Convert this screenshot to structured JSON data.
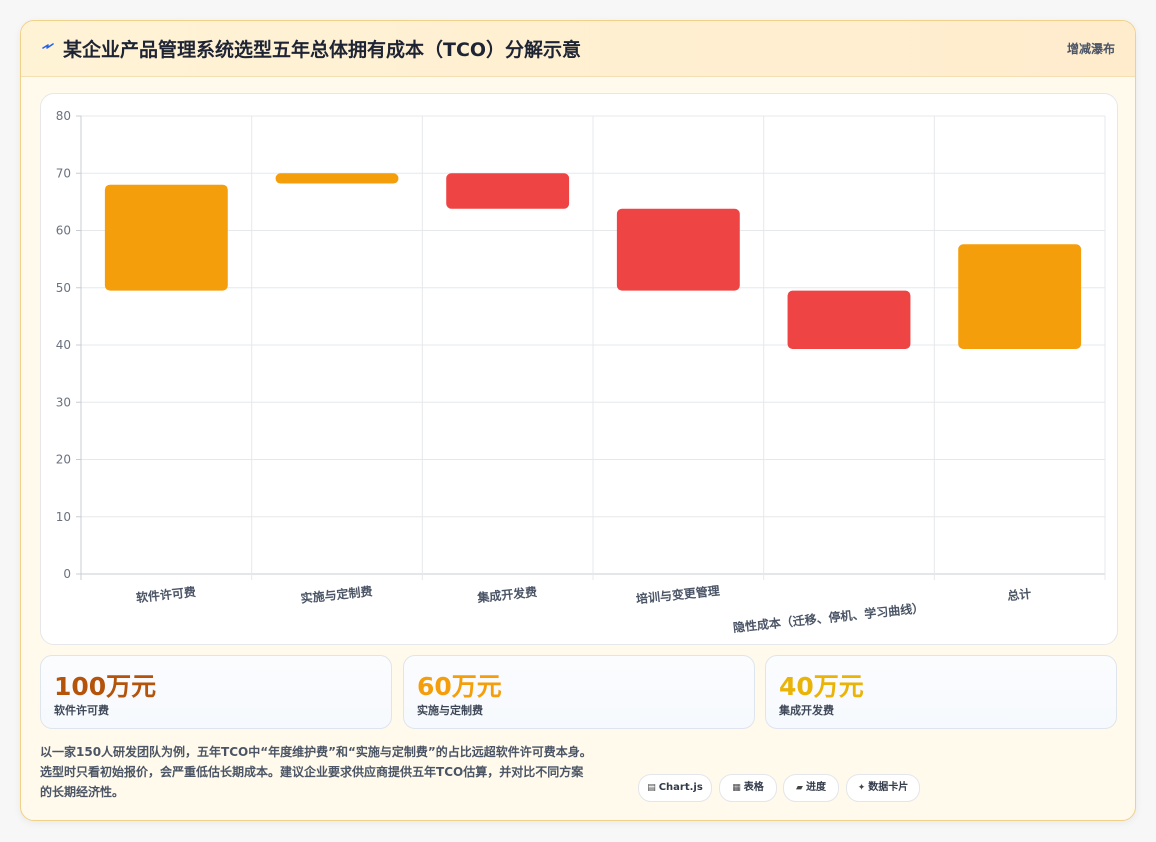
{
  "header": {
    "title": "某企业产品管理系统选型五年总体拥有成本（TCO）分解示意",
    "tag": "增减瀑布",
    "icon": "lightning-icon"
  },
  "chart_data": {
    "type": "bar",
    "subtype": "waterfall",
    "categories": [
      "软件许可费",
      "实施与定制费",
      "集成开发费",
      "培训与变更管理",
      "隐性成本（迁移、停机、学习曲线）",
      "总计"
    ],
    "bars": [
      {
        "low": 49.5,
        "high": 68,
        "color": "#f59e0b"
      },
      {
        "low": 68.2,
        "high": 70,
        "color": "#f59e0b"
      },
      {
        "low": 63.8,
        "high": 70,
        "color": "#ef4444"
      },
      {
        "low": 49.5,
        "high": 63.8,
        "color": "#ef4444"
      },
      {
        "low": 39.3,
        "high": 49.5,
        "color": "#ef4444"
      },
      {
        "low": 39.3,
        "high": 57.6,
        "color": "#f59e0b"
      }
    ],
    "ylim": [
      0,
      80
    ],
    "yticks": [
      0,
      10,
      20,
      30,
      40,
      50,
      60,
      70,
      80
    ],
    "grid": true,
    "legend": "none"
  },
  "stats": [
    {
      "value": "100万元",
      "label": "软件许可费",
      "color": "#b45309"
    },
    {
      "value": "60万元",
      "label": "实施与定制费",
      "color": "#f59e0b"
    },
    {
      "value": "40万元",
      "label": "集成开发费",
      "color": "#eab308"
    }
  ],
  "note": {
    "line1": "以一家150人研发团队为例，五年TCO中“年度维护费”和“实施与定制费”的占比远超软件许可费本身。",
    "line2": "选型时只看初始报价，会严重低估长期成本。建议企业要求供应商提供五年TCO估算，并对比不同方案",
    "line3": "的长期经济性。"
  },
  "chips": [
    {
      "label": "Chart.js",
      "icon": "chart-icon",
      "glyph": "▤"
    },
    {
      "label": "表格",
      "icon": "table-icon",
      "glyph": "▦"
    },
    {
      "label": "进度",
      "icon": "progress-icon",
      "glyph": "▰"
    },
    {
      "label": "数据卡片",
      "icon": "sparkle-icon",
      "glyph": "✦"
    }
  ]
}
